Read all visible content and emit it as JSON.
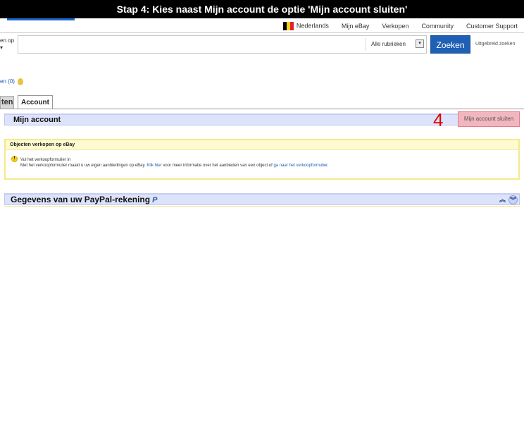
{
  "banner": {
    "text": "Stap 4: Kies naast Mijn account de optie 'Mijn account sluiten'"
  },
  "topnav": {
    "language": "Nederlands",
    "items": [
      "Mijn eBay",
      "Verkopen",
      "Community",
      "Customer Support"
    ]
  },
  "search": {
    "label_line1": "en op",
    "label_arrow": "▾",
    "category": "Alle rubrieken",
    "category_arrow": "▾",
    "button": "Zoeken",
    "advanced": "Uitgebreid zoeken"
  },
  "user": {
    "text": "en (0)"
  },
  "tabs": {
    "inactive": "ten",
    "active": "Account"
  },
  "mijn_account": {
    "title": "Mijn account",
    "step_number": "4",
    "close_button": "Mijn account sluiten"
  },
  "notice": {
    "header": "Objecten verkopen op eBay",
    "icon_glyph": "!",
    "title": "Vul het verkoopformulier in",
    "text_before": "Met het verkoopformulier maakt u uw eigen aanbiedingen op eBay. ",
    "link1": "Klik hier",
    "text_mid": " voor meer informatie over het aanbieden van een object of ",
    "link2": "ga naar het verkoopformulier",
    "text_after": "."
  },
  "paypal": {
    "title": "Gegevens van uw PayPal-rekening",
    "logo": "P",
    "up_glyph": "︽",
    "down_glyph": "︾"
  },
  "colors": {
    "section_header_bg": "#dde3fa",
    "highlight_bg": "#f2b6bf",
    "step_number": "#e00000",
    "search_button": "#1f5fb4"
  }
}
